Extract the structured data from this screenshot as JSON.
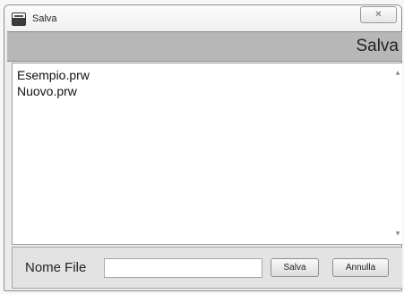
{
  "window": {
    "title": "Salva",
    "app_icon": "printer-app-icon",
    "close_glyph": "✕"
  },
  "header": {
    "title": "Salva"
  },
  "file_list": {
    "items": [
      {
        "name": "Esempio.prw"
      },
      {
        "name": "Nuovo.prw"
      }
    ],
    "scroll_up_glyph": "▲",
    "scroll_down_glyph": "▼"
  },
  "footer": {
    "filename_label": "Nome File",
    "filename_value": "",
    "save_label": "Salva",
    "cancel_label": "Annulla"
  }
}
